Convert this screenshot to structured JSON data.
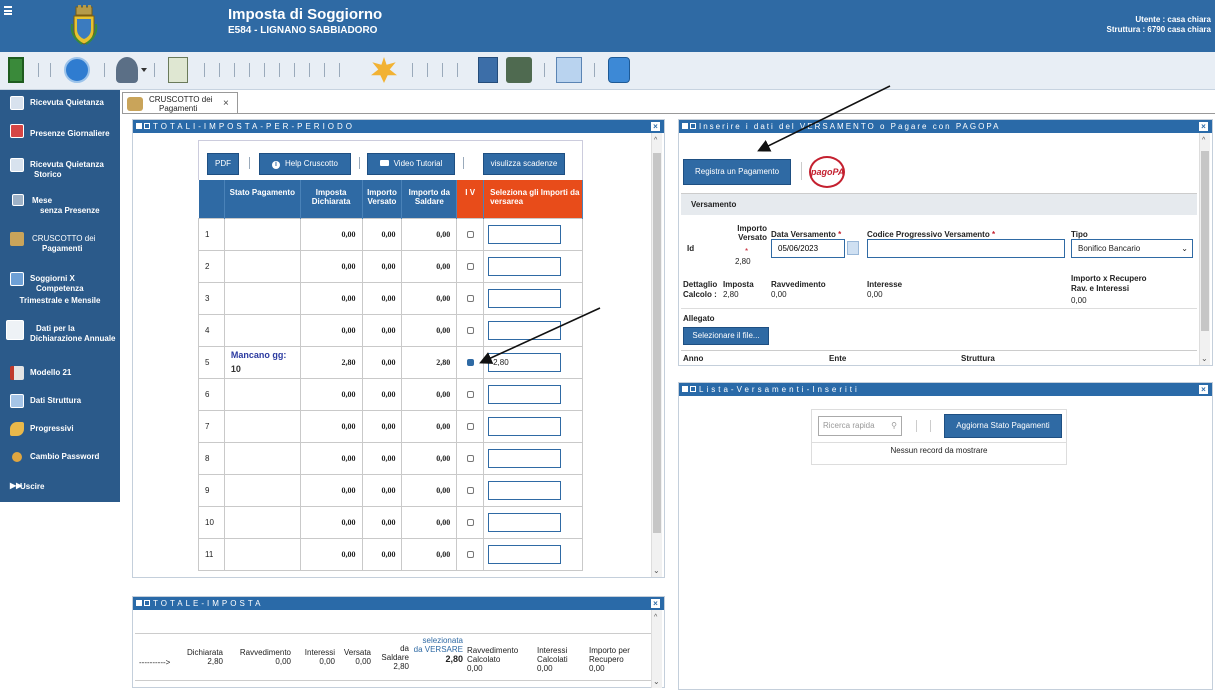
{
  "header": {
    "title": "Imposta di Soggiorno",
    "subtitle": "E584 - LIGNANO SABBIADORO",
    "user_line1": "Utente : casa chiara",
    "user_line2": "Struttura : 6790 casa chiara"
  },
  "sidebar": {
    "items": [
      {
        "label1": "Ricevuta Quietanza",
        "label2": ""
      },
      {
        "label1": "Presenze Giornaliere",
        "label2": ""
      },
      {
        "label1": "Ricevuta Quietanza",
        "label2": "Storico"
      },
      {
        "label1": "Mese",
        "label2": "senza Presenze"
      },
      {
        "label1": "CRUSCOTTO dei",
        "label2": "Pagamenti"
      },
      {
        "label1": "Soggiorni X",
        "label2": "Competenza"
      },
      {
        "label1": "Dati per la",
        "label2": "Dichiarazione Annuale"
      },
      {
        "label1": "Modello 21",
        "label2": ""
      },
      {
        "label1": "Dati Struttura",
        "label2": ""
      },
      {
        "label1": "Progressivi",
        "label2": ""
      },
      {
        "label1": "Cambio Password",
        "label2": ""
      },
      {
        "label1": "Uscire",
        "label2": ""
      }
    ],
    "item5_label3": "Trimestrale e Mensile"
  },
  "tab": {
    "line1": "CRUSCOTTO dei",
    "line2": "Pagamenti",
    "close": "×"
  },
  "totali_panel": {
    "title": "TOTALI-IMPOSTA-PER-PERIODO",
    "buttons": {
      "pdf": "PDF",
      "help": "Help Cruscotto",
      "video": "Video Tutorial",
      "scadenze": "visulizza scadenze"
    },
    "columns": [
      "",
      "Stato Pagamento",
      "Imposta Dichiarata",
      "Importo Versato",
      "Importo da Saldare",
      "I V",
      "Seleziona gli Importi da versarea"
    ],
    "rows": [
      {
        "n": "1",
        "stato": "",
        "dich": "0,00",
        "vers": "0,00",
        "saldo": "0,00",
        "checked": false,
        "input": ""
      },
      {
        "n": "2",
        "stato": "",
        "dich": "0,00",
        "vers": "0,00",
        "saldo": "0,00",
        "checked": false,
        "input": ""
      },
      {
        "n": "3",
        "stato": "",
        "dich": "0,00",
        "vers": "0,00",
        "saldo": "0,00",
        "checked": false,
        "input": ""
      },
      {
        "n": "4",
        "stato": "",
        "dich": "0,00",
        "vers": "0,00",
        "saldo": "0,00",
        "checked": false,
        "input": ""
      },
      {
        "n": "5",
        "stato": "Mancano gg:",
        "stato2": "10",
        "dich": "2,80",
        "vers": "0,00",
        "saldo": "2,80",
        "checked": true,
        "input": "2,80"
      },
      {
        "n": "6",
        "stato": "",
        "dich": "0,00",
        "vers": "0,00",
        "saldo": "0,00",
        "checked": false,
        "input": ""
      },
      {
        "n": "7",
        "stato": "",
        "dich": "0,00",
        "vers": "0,00",
        "saldo": "0,00",
        "checked": false,
        "input": ""
      },
      {
        "n": "8",
        "stato": "",
        "dich": "0,00",
        "vers": "0,00",
        "saldo": "0,00",
        "checked": false,
        "input": ""
      },
      {
        "n": "9",
        "stato": "",
        "dich": "0,00",
        "vers": "0,00",
        "saldo": "0,00",
        "checked": false,
        "input": ""
      },
      {
        "n": "10",
        "stato": "",
        "dich": "0,00",
        "vers": "0,00",
        "saldo": "0,00",
        "checked": false,
        "input": ""
      },
      {
        "n": "11",
        "stato": "",
        "dich": "0,00",
        "vers": "0,00",
        "saldo": "0,00",
        "checked": false,
        "input": ""
      }
    ]
  },
  "totale_panel": {
    "title": "TOTALE-IMPOSTA",
    "arrow": "---------->",
    "cols": [
      {
        "h": "Dichiarata",
        "v": "2,80"
      },
      {
        "h": "Ravvedimento",
        "v": "0,00"
      },
      {
        "h": "Interessi",
        "v": "0,00"
      },
      {
        "h": "Versata",
        "v": "0,00"
      },
      {
        "h": "da Saldare",
        "v": "2,80"
      },
      {
        "h": "selezionata da VERSARE",
        "v": "2,80"
      },
      {
        "h": "Ravvedimento Calcolato",
        "v": "0,00"
      },
      {
        "h": "Interessi Calcolati",
        "v": "0,00"
      },
      {
        "h": "Importo per Recupero",
        "v": "0,00"
      }
    ]
  },
  "versamenti_panel": {
    "title": "Inserire i dati del VERSAMENTO o Pagare con PAGOPA",
    "register_button": "Registra un Pagamento",
    "pagopa_logo": "pagoPA",
    "section": "Versamento",
    "id_label": "Id",
    "importo_label": "Importo Versato",
    "importo_req": "*",
    "importo_value": "2,80",
    "data_label": "Data Versamento",
    "data_value": "05/06/2023",
    "codice_label": "Codice Progressivo Versamento",
    "codice_value": "",
    "tipo_label": "Tipo",
    "tipo_value": "Bonifico Bancario",
    "dettaglio_label": "Dettaglio Calcolo :",
    "imposta_label": "Imposta",
    "imposta_value": "2,80",
    "ravv_label": "Ravvedimento",
    "ravv_value": "0,00",
    "interesse_label": "Interesse",
    "interesse_value": "0,00",
    "recupero_label1": "Importo x Recupero",
    "recupero_label2": "Rav. e Interessi",
    "recupero_value": "0,00",
    "allegato_label": "Allegato",
    "file_button": "Selezionare il file...",
    "foot_anno": "Anno",
    "foot_ente": "Ente",
    "foot_struttura": "Struttura"
  },
  "lista_panel": {
    "title": "Lista-Versamenti-Inseriti",
    "search_placeholder": "Ricerca rapida",
    "update_button": "Aggiorna Stato Pagamenti",
    "empty": "Nessun record da mostrare"
  },
  "colors": {
    "primary": "#2f6aa4",
    "sidebar": "#2b5a8a",
    "accent": "#e84c1a",
    "pagopa": "#c4202f"
  }
}
